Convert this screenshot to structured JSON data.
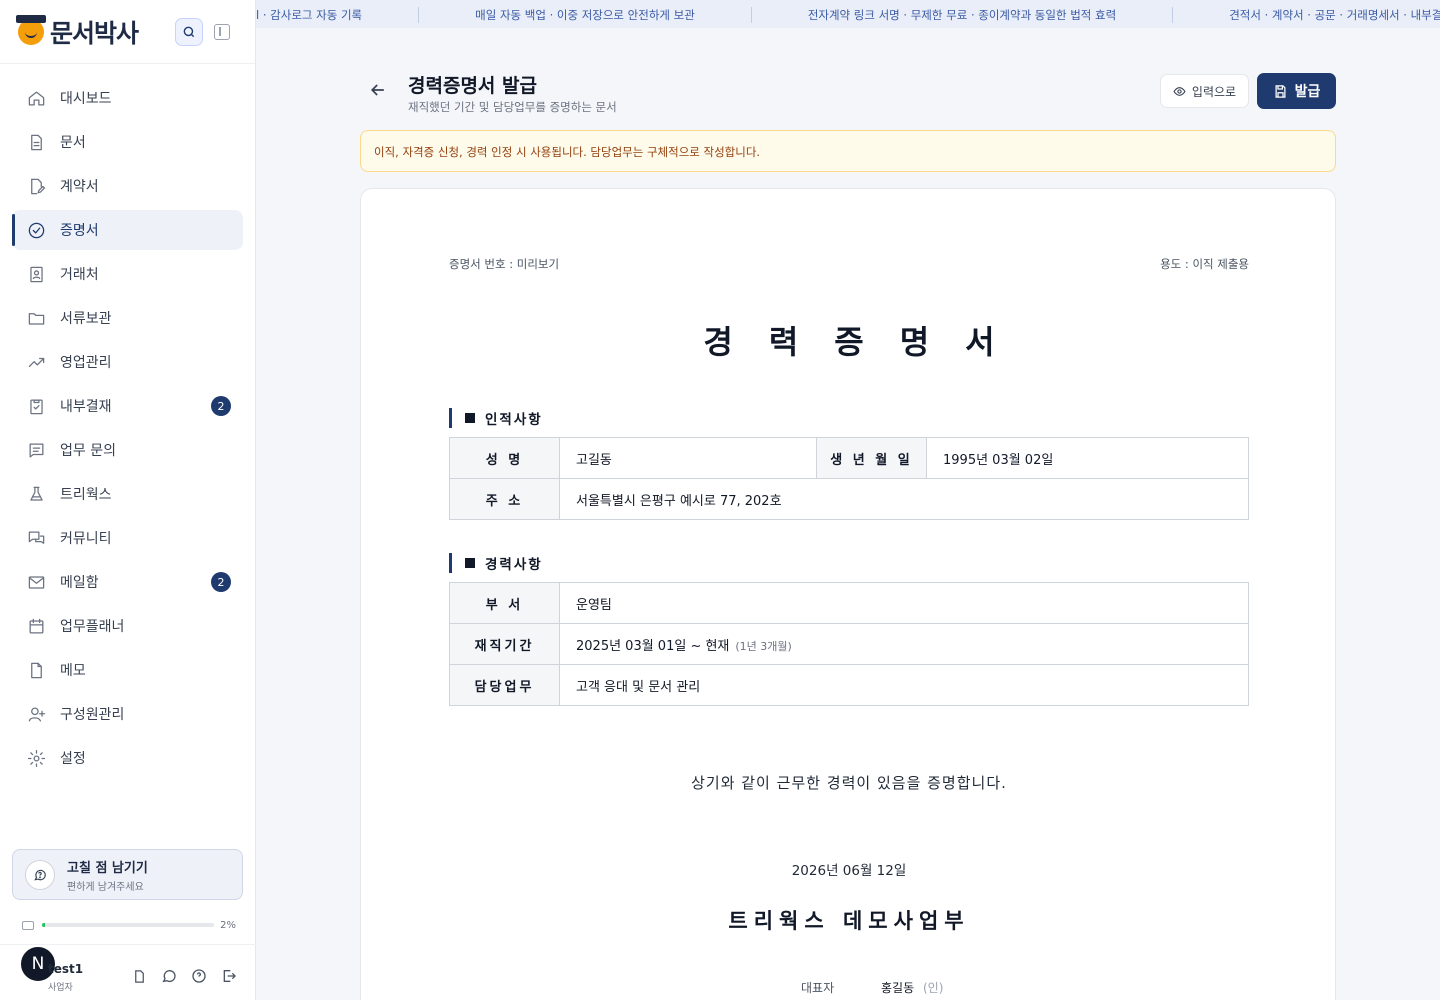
{
  "app": {
    "brand": "문서박사",
    "colors": {
      "primary": "#1e3a6e",
      "notice_bg": "#fffbeb",
      "notice_text": "#92400e",
      "ticker_text": "#3b5ba5"
    }
  },
  "ticker": [
    "l · 감사로그 자동 기록",
    "매일 자동 백업 · 이중 저장으로 안전하게 보관",
    "전자계약 링크 서명 · 무제한 무료 · 종이계약과 동일한 법적 효력",
    "견적서 · 계약서 · 공문 · 거래명세서 · 내부결재"
  ],
  "sidebar": {
    "items": [
      {
        "label": "대시보드",
        "icon": "home-icon"
      },
      {
        "label": "문서",
        "icon": "document-icon"
      },
      {
        "label": "계약서",
        "icon": "contract-edit-icon"
      },
      {
        "label": "증명서",
        "icon": "check-circle-icon",
        "active": true
      },
      {
        "label": "거래처",
        "icon": "contact-card-icon"
      },
      {
        "label": "서류보관",
        "icon": "folder-icon"
      },
      {
        "label": "영업관리",
        "icon": "trend-icon"
      },
      {
        "label": "내부결재",
        "icon": "clipboard-check-icon",
        "badge": "2"
      },
      {
        "label": "업무 문의",
        "icon": "message-square-icon"
      },
      {
        "label": "트리웍스",
        "icon": "flask-icon"
      },
      {
        "label": "커뮤니티",
        "icon": "chat-bubbles-icon"
      },
      {
        "label": "메일함",
        "icon": "mail-icon",
        "badge": "2"
      },
      {
        "label": "업무플래너",
        "icon": "calendar-icon"
      },
      {
        "label": "메모",
        "icon": "memo-icon"
      },
      {
        "label": "구성원관리",
        "icon": "user-plus-icon"
      },
      {
        "label": "설정",
        "icon": "gear-icon"
      }
    ],
    "feedback": {
      "title": "고칠 점 남기기",
      "subtitle": "편하게 남겨주세요"
    },
    "storage": {
      "percent_label": "2%",
      "fraction": 0.02
    },
    "user": {
      "avatar_letter": "N",
      "name": "test1",
      "role": "사업자"
    }
  },
  "header": {
    "title": "경력증명서 발급",
    "subtitle": "재직했던 기간 및 담당업무를 증명하는 문서",
    "input_button": "입력으로",
    "issue_button": "발급"
  },
  "notice": "이직, 자격증 신청, 경력 인정 시 사용됩니다. 담당업무는 구체적으로 작성합니다.",
  "document": {
    "number_label": "증명서 번호 : 미리보기",
    "purpose_label": "용도 : 이직 제출용",
    "title": "경력증명서",
    "personal": {
      "section_title": "인적사항",
      "name_label": "성 명",
      "name": "고길동",
      "birth_label": "생 년 월 일",
      "birth": "1995년 03월 02일",
      "address_label": "주 소",
      "address": "서울특별시 은평구 예시로 77, 202호"
    },
    "career": {
      "section_title": "경력사항",
      "dept_label": "부 서",
      "dept": "운영팀",
      "period_label": "재직기간",
      "period": "2025년 03월 01일 ~ 현재",
      "duration": "(1년 3개월)",
      "duty_label": "담당업무",
      "duty": "고객 응대 및 문서 관리"
    },
    "statement": "상기와 같이 근무한 경력이 있음을 증명합니다.",
    "date": "2026년 06월 12일",
    "company": "트리웍스 데모사업부",
    "rep_label": "대표자",
    "rep_name": "홍길동",
    "seal": "(인)"
  }
}
